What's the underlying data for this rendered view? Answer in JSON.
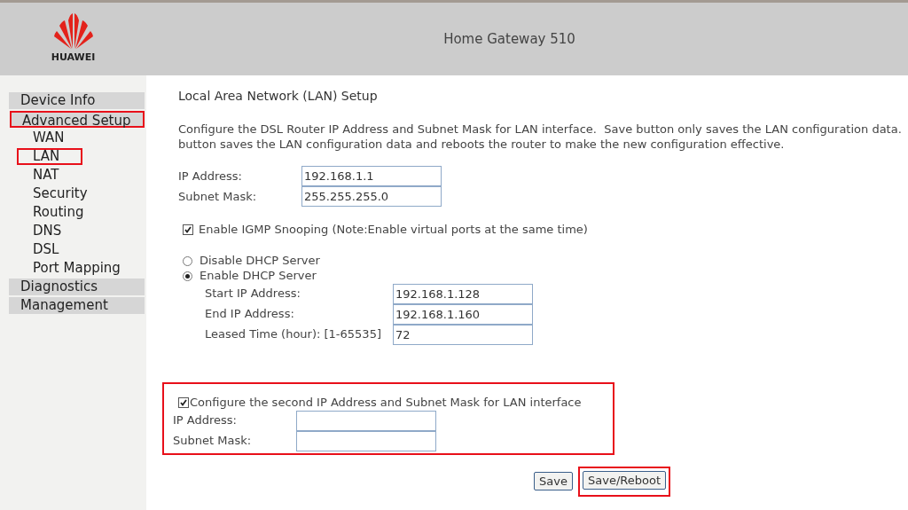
{
  "header": {
    "brand": "HUAWEI",
    "title": "Home Gateway 510"
  },
  "sidebar": {
    "items": [
      {
        "label": "Device Info",
        "highlighted": false
      },
      {
        "label": "Advanced Setup",
        "highlighted": true,
        "children": [
          {
            "label": "WAN",
            "highlighted": false
          },
          {
            "label": "LAN",
            "highlighted": true
          },
          {
            "label": "NAT",
            "highlighted": false
          },
          {
            "label": "Security",
            "highlighted": false
          },
          {
            "label": "Routing",
            "highlighted": false
          },
          {
            "label": "DNS",
            "highlighted": false
          },
          {
            "label": "DSL",
            "highlighted": false
          },
          {
            "label": "Port Mapping",
            "highlighted": false
          }
        ]
      },
      {
        "label": "Diagnostics",
        "highlighted": false
      },
      {
        "label": "Management",
        "highlighted": false
      }
    ]
  },
  "main": {
    "title": "Local Area Network (LAN) Setup",
    "description": [
      "Configure the DSL Router IP Address and Subnet Mask for LAN interface.  Save button only saves the LAN configuration data.",
      "button saves the LAN configuration data and reboots the router to make the new configuration effective."
    ],
    "lan_fields": [
      {
        "label": "IP Address:",
        "value": "192.168.1.1"
      },
      {
        "label": "Subnet Mask:",
        "value": "255.255.255.0"
      }
    ],
    "igmp": {
      "label": "Enable IGMP Snooping (Note:Enable virtual ports at the same time)",
      "checked": true
    },
    "dhcp_options": [
      {
        "label": "Disable DHCP Server",
        "selected": false
      },
      {
        "label": "Enable DHCP Server",
        "selected": true
      }
    ],
    "dhcp_fields": [
      {
        "label": "Start IP Address:",
        "value": "192.168.1.128"
      },
      {
        "label": "End IP Address:",
        "value": "192.168.1.160"
      },
      {
        "label": "Leased Time (hour): [1-65535]",
        "value": "72"
      }
    ],
    "second_ip": {
      "label": "Configure the second IP Address and Subnet Mask for LAN interface",
      "checked": true,
      "highlighted": true,
      "fields": [
        {
          "label": "IP Address:"
        },
        {
          "label": "Subnet Mask:"
        }
      ]
    },
    "buttons": [
      {
        "label": "Save",
        "highlighted": false
      },
      {
        "label": "Save/Reboot",
        "highlighted": true
      }
    ]
  }
}
